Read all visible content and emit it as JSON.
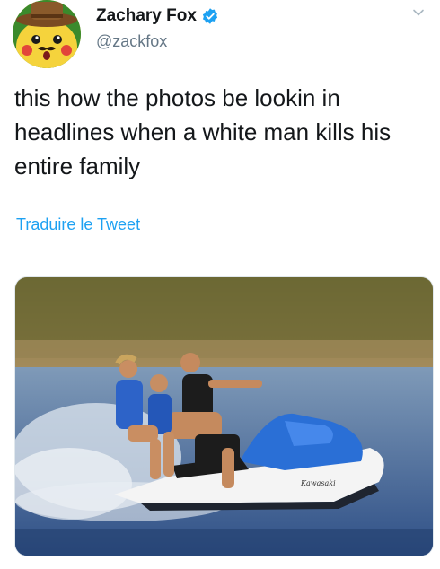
{
  "user": {
    "display_name": "Zachary Fox",
    "handle": "@zackfox",
    "verified": true,
    "avatar_icon": "pikachu-cowboy-hat-avatar"
  },
  "tweet": {
    "text": "this how the photos be lookin in headlines when a white man kills his entire family",
    "translate_label": "Traduire le Tweet"
  },
  "media": {
    "description_icon": "family-jetski-photo",
    "brand_text": "Kawasaki"
  },
  "colors": {
    "link_blue": "#1da1f2",
    "handle_gray": "#657786",
    "text_dark": "#14171a",
    "verified_blue": "#1da1f2"
  }
}
